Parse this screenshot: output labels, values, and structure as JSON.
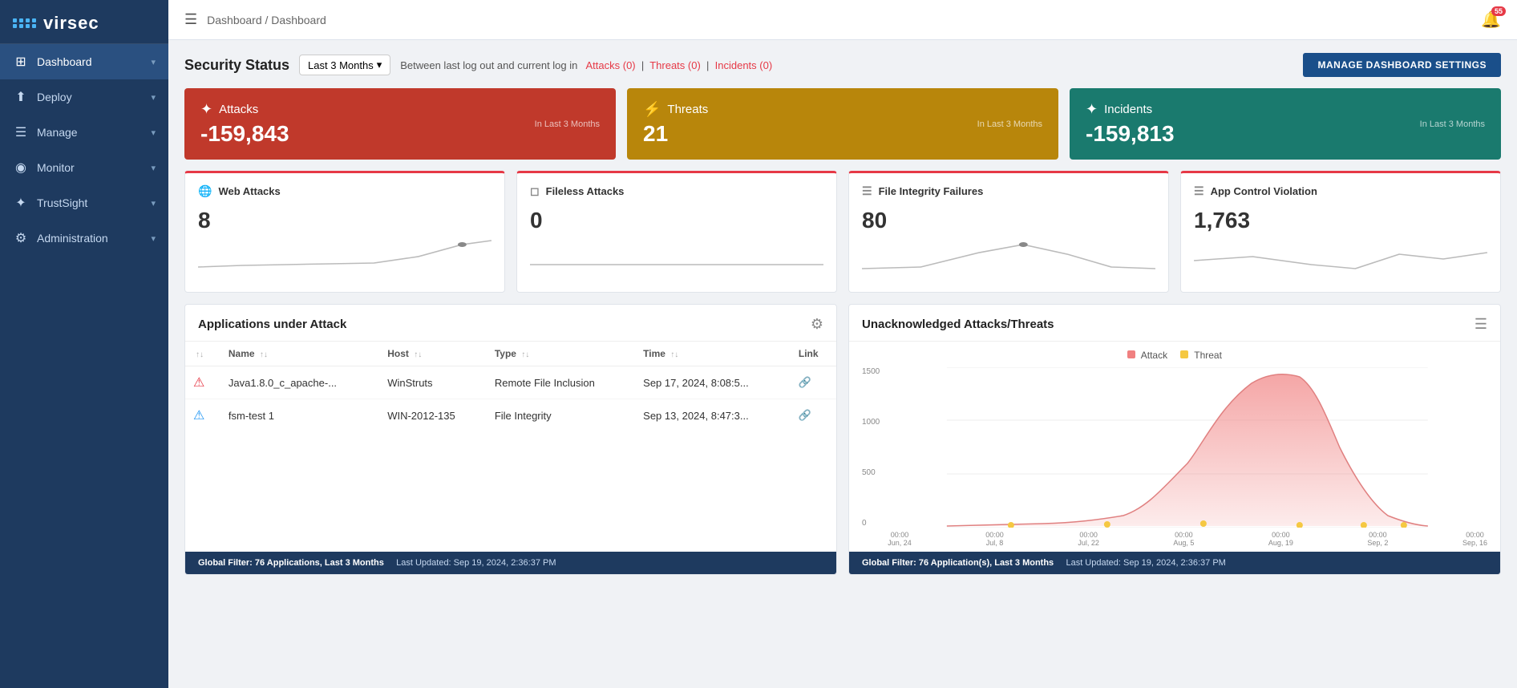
{
  "sidebar": {
    "logo": "virsec",
    "items": [
      {
        "id": "dashboard",
        "label": "Dashboard",
        "icon": "⊞",
        "active": true,
        "hasChevron": true
      },
      {
        "id": "deploy",
        "label": "Deploy",
        "icon": "⬆",
        "active": false,
        "hasChevron": true
      },
      {
        "id": "manage",
        "label": "Manage",
        "icon": "☰",
        "active": false,
        "hasChevron": true
      },
      {
        "id": "monitor",
        "label": "Monitor",
        "icon": "◉",
        "active": false,
        "hasChevron": true
      },
      {
        "id": "trustsight",
        "label": "TrustSight",
        "icon": "✦",
        "active": false,
        "hasChevron": true
      },
      {
        "id": "administration",
        "label": "Administration",
        "icon": "⚙",
        "active": false,
        "hasChevron": true
      }
    ]
  },
  "topbar": {
    "breadcrumb": "Dashboard / Dashboard",
    "notification_count": "55"
  },
  "security_status": {
    "title": "Security Status",
    "filter_label": "Last 3 Months",
    "info_prefix": "Between last log out and current log in",
    "attacks_link": "Attacks (0)",
    "threats_link": "Threats (0)",
    "incidents_link": "Incidents (0)",
    "manage_btn": "MANAGE DASHBOARD SETTINGS"
  },
  "stat_cards": [
    {
      "type": "red",
      "icon": "✦",
      "title": "Attacks",
      "value": "-159,843",
      "period": "In Last 3 Months"
    },
    {
      "type": "gold",
      "icon": "⚡",
      "title": "Threats",
      "value": "21",
      "period": "In Last 3 Months"
    },
    {
      "type": "teal",
      "icon": "✦",
      "title": "Incidents",
      "value": "-159,813",
      "period": "In Last 3 Months"
    }
  ],
  "mini_cards": [
    {
      "icon": "🌐",
      "title": "Web Attacks",
      "value": "8",
      "sparkline": "flat-up"
    },
    {
      "icon": "☐",
      "title": "Fileless Attacks",
      "value": "0",
      "sparkline": "flat"
    },
    {
      "icon": "☰",
      "title": "File Integrity Failures",
      "value": "80",
      "sparkline": "peak"
    },
    {
      "icon": "☰",
      "title": "App Control Violation",
      "value": "1,763",
      "sparkline": "dip"
    }
  ],
  "apps_panel": {
    "title": "Applications under Attack",
    "columns": [
      "",
      "Name",
      "Host",
      "Type",
      "Time",
      "Link"
    ],
    "rows": [
      {
        "icon": "warning-red",
        "name": "Java1.8.0_c_apache-...",
        "host": "WinStruts",
        "type": "Remote File Inclusion",
        "time": "Sep 17, 2024, 8:08:5...",
        "has_link": true
      },
      {
        "icon": "warning-blue",
        "name": "fsm-test 1",
        "host": "WIN-2012-135",
        "type": "File Integrity",
        "time": "Sep 13, 2024, 8:47:3...",
        "has_link": true
      }
    ],
    "footer": "Global Filter: 76 Applications, Last 3 Months",
    "footer_updated": "Last Updated: Sep 19, 2024, 2:36:37 PM"
  },
  "attacks_panel": {
    "title": "Unacknowledged Attacks/Threats",
    "legend": {
      "attack": "Attack",
      "threat": "Threat"
    },
    "y_labels": [
      "1500",
      "1000",
      "500",
      "0"
    ],
    "x_labels": [
      "00:00\nJun, 24",
      "00:00\nJul, 8",
      "00:00\nJul, 22",
      "00:00\nAug, 5",
      "00:00\nAug, 19",
      "00:00\nSep, 2",
      "00:00\nSep, 16"
    ],
    "footer": "Global Filter: 76 Application(s), Last 3 Months",
    "footer_updated": "Last Updated: Sep 19, 2024, 2:36:37 PM"
  }
}
